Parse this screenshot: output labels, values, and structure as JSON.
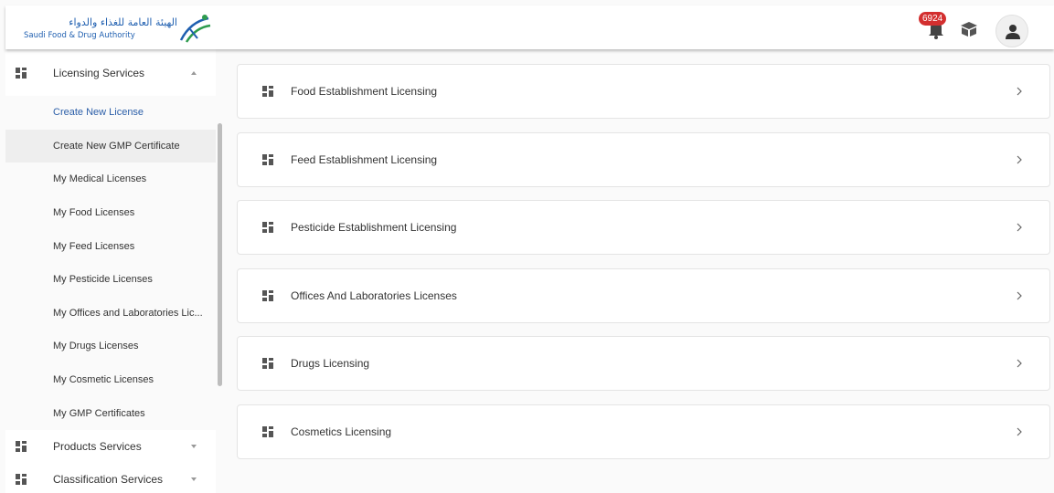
{
  "header": {
    "logo_arabic": "الهيئة العامة للغذاء والدواء",
    "logo_english": "Saudi Food & Drug Authority",
    "notification_count": "6924"
  },
  "sidebar": {
    "licensing": {
      "label": "Licensing Services",
      "items": [
        "Create New License",
        "Create New GMP Certificate",
        "My Medical Licenses",
        "My Food Licenses",
        "My Feed Licenses",
        "My Pesticide Licenses",
        "My Offices and Laboratories Lic...",
        "My Drugs Licenses",
        "My Cosmetic Licenses",
        "My GMP Certificates"
      ]
    },
    "products": {
      "label": "Products Services"
    },
    "classification": {
      "label": "Classification Services"
    }
  },
  "cards": [
    "Food Establishment Licensing",
    "Feed Establishment Licensing",
    "Pesticide Establishment Licensing",
    "Offices And Laboratories Licenses",
    "Drugs Licensing",
    "Cosmetics Licensing"
  ],
  "colors": {
    "accent": "#2b5ea8",
    "badge": "#d32f2f",
    "logo": "#1f5fb0"
  }
}
